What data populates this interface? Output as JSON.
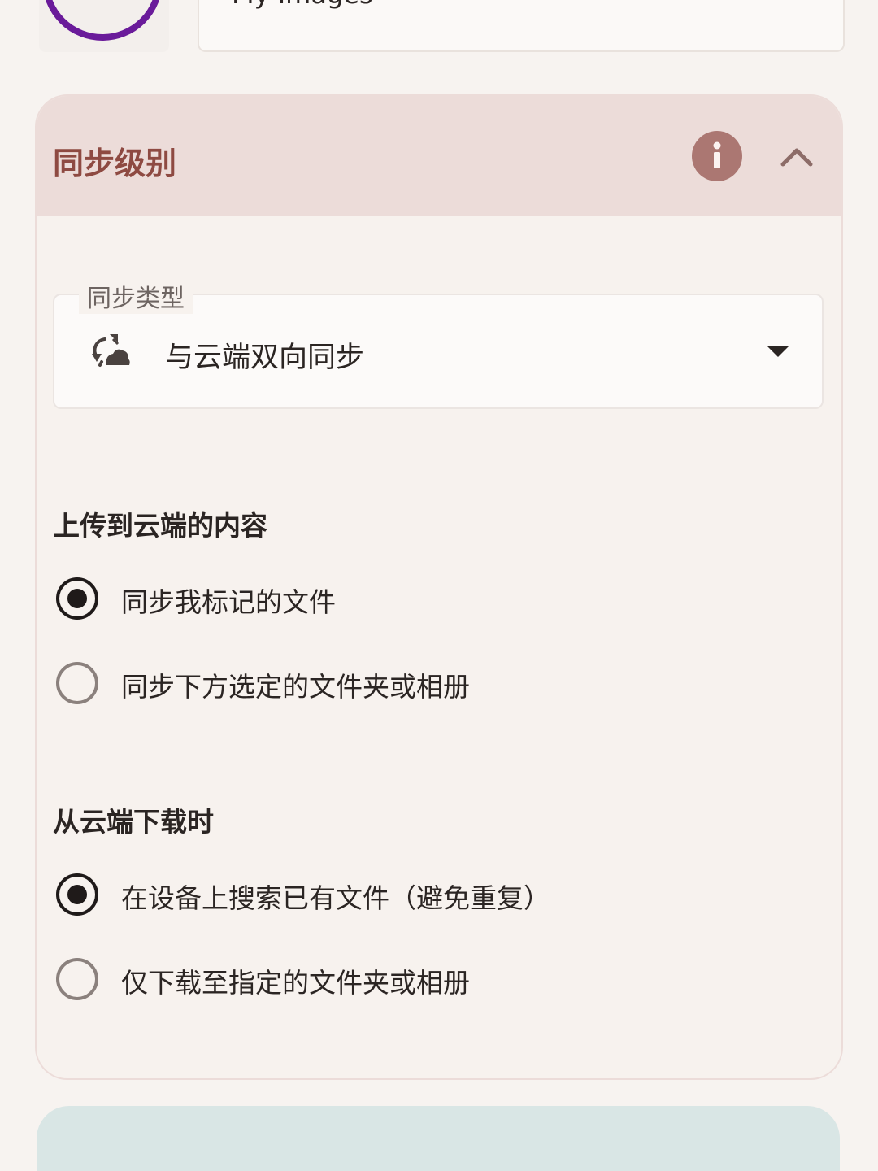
{
  "album": {
    "name": "My Images",
    "accent_color": "#6a1b9a",
    "icon": "star-icon"
  },
  "sync_level": {
    "title": "同步级别",
    "info_icon": "info-icon",
    "collapse_icon": "chevron-up-icon",
    "header_color": "#ecdcd9",
    "title_color": "#8e4a42",
    "sync_type": {
      "label": "同步类型",
      "value": "与云端双向同步",
      "icon": "cloud-sync-icon",
      "dropdown_icon": "caret-down-icon"
    },
    "upload": {
      "heading": "上传到云端的内容",
      "options": [
        {
          "label": "同步我标记的文件",
          "selected": true
        },
        {
          "label": "同步下方选定的文件夹或相册",
          "selected": false
        }
      ]
    },
    "download": {
      "heading": "从云端下载时",
      "options": [
        {
          "label": "在设备上搜索已有文件（避免重复）",
          "selected": true
        },
        {
          "label": "仅下载至指定的文件夹或相册",
          "selected": false
        }
      ]
    }
  }
}
